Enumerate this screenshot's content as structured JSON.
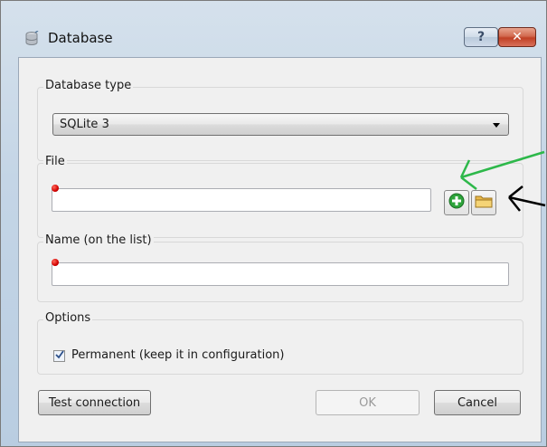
{
  "window": {
    "title": "Database",
    "help_button": "?",
    "close_button": "✕"
  },
  "database_type": {
    "label": "Database type",
    "selected": "SQLite 3"
  },
  "file": {
    "label": "File",
    "value": ""
  },
  "name": {
    "label": "Name (on the list)",
    "value": ""
  },
  "options": {
    "label": "Options",
    "permanent_label": "Permanent (keep it in configuration)",
    "permanent_checked": true
  },
  "buttons": {
    "test_connection": "Test connection",
    "ok": "OK",
    "cancel": "Cancel"
  },
  "annotations": {
    "green_arrow_color": "#2db84a",
    "black_arrow_color": "#000000"
  }
}
